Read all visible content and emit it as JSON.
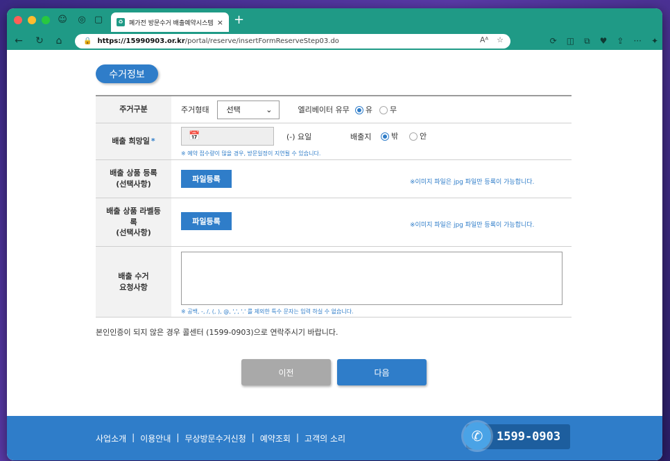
{
  "browser": {
    "tab_title": "폐가전 방문수거 배출예약시스템",
    "tab_close": "×",
    "new_tab": "+",
    "url_host": "https://15990903.or.kr",
    "url_path": "/portal/reserve/insertFormReserveStep03.do"
  },
  "section_title": "수거정보",
  "form": {
    "collection_type": {
      "label": "주거구분",
      "housing_label": "주거형태",
      "housing_select": "선택",
      "elevator_label": "엘리베이터 유무",
      "elevator_yes": "유",
      "elevator_no": "무"
    },
    "desired_date": {
      "label": "배출 희망일",
      "required_mark": "*",
      "day_label": "(-) 요일",
      "location_label": "배출지",
      "location_out": "밖",
      "location_in": "안",
      "note": "※ 예약 접수량이 많을 경우, 방문일정이 지연될 수 있습니다."
    },
    "product_register": {
      "label_line1": "배출 상품 등록",
      "label_line2": "(선택사항)",
      "button": "파일등록",
      "note": "※이미지 파일은 jpg 파일만 등록이 가능합니다."
    },
    "label_register": {
      "label_line1": "배출 상품 라벨등",
      "label_line2": "록",
      "label_line3": "(선택사항)",
      "button": "파일등록",
      "note": "※이미지 파일은 jpg 파일만 등록이 가능합니다."
    },
    "request": {
      "label_line1": "배출 수거",
      "label_line2": "요청사항",
      "note": "※ 공백, -, /, (, ), @, ',', '.' 를 제외한 특수 문자는 입력 하실 수 없습니다."
    }
  },
  "verification_notice": "본인인증이 되지 않은 경우 콜센터 (1599-0903)으로 연락주시기 바랍니다.",
  "buttons": {
    "prev": "이전",
    "next": "다음"
  },
  "footer": {
    "links": [
      "사업소개",
      "이용안내",
      "무상방문수거신청",
      "예약조회",
      "고객의 소리"
    ],
    "separator": "|",
    "phone": "1599-0903"
  },
  "colors": {
    "browser_chrome": "#1f9a86",
    "accent": "#2f7dc9",
    "button_disabled": "#a9a9a9"
  }
}
